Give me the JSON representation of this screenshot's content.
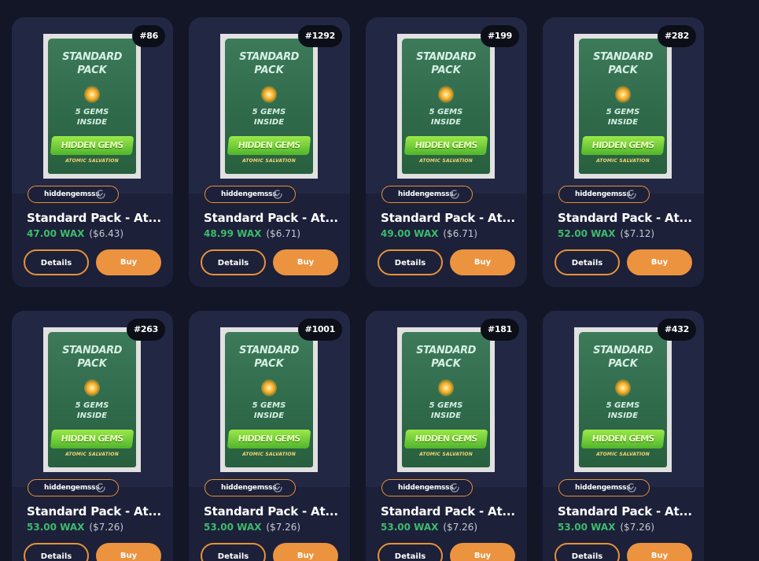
{
  "listings": [
    {
      "mint": "#86",
      "collection": "hiddengemsss",
      "name": "Standard Pack - At...",
      "price_wax": "47.00 WAX",
      "price_usd": "($6.43)",
      "details_label": "Details",
      "buy_label": "Buy"
    },
    {
      "mint": "#1292",
      "collection": "hiddengemsss",
      "name": "Standard Pack - At...",
      "price_wax": "48.99 WAX",
      "price_usd": "($6.71)",
      "details_label": "Details",
      "buy_label": "Buy"
    },
    {
      "mint": "#199",
      "collection": "hiddengemsss",
      "name": "Standard Pack - At...",
      "price_wax": "49.00 WAX",
      "price_usd": "($6.71)",
      "details_label": "Details",
      "buy_label": "Buy"
    },
    {
      "mint": "#282",
      "collection": "hiddengemsss",
      "name": "Standard Pack - At...",
      "price_wax": "52.00 WAX",
      "price_usd": "($7.12)",
      "details_label": "Details",
      "buy_label": "Buy"
    },
    {
      "mint": "#263",
      "collection": "hiddengemsss",
      "name": "Standard Pack - At...",
      "price_wax": "53.00 WAX",
      "price_usd": "($7.26)",
      "details_label": "Details",
      "buy_label": "Buy"
    },
    {
      "mint": "#1001",
      "collection": "hiddengemsss",
      "name": "Standard Pack - At...",
      "price_wax": "53.00 WAX",
      "price_usd": "($7.26)",
      "details_label": "Details",
      "buy_label": "Buy"
    },
    {
      "mint": "#181",
      "collection": "hiddengemsss",
      "name": "Standard Pack - At...",
      "price_wax": "53.00 WAX",
      "price_usd": "($7.26)",
      "details_label": "Details",
      "buy_label": "Buy"
    },
    {
      "mint": "#432",
      "collection": "hiddengemsss",
      "name": "Standard Pack - At...",
      "price_wax": "53.00 WAX",
      "price_usd": "($7.26)",
      "details_label": "Details",
      "buy_label": "Buy"
    }
  ],
  "pack_art": {
    "line1": "STANDARD",
    "line2": "PACK",
    "line3": "5 GEMS",
    "line4": "INSIDE",
    "brand": "HIDDEN GEMS",
    "tagline": "ATOMIC SALVATION"
  },
  "colors": {
    "accent": "#ec9340",
    "price_green": "#3dbb6d",
    "card_bg": "#1c2039",
    "page_bg": "#131627"
  },
  "icons": {
    "collection_verified": "verified-check-icon"
  }
}
